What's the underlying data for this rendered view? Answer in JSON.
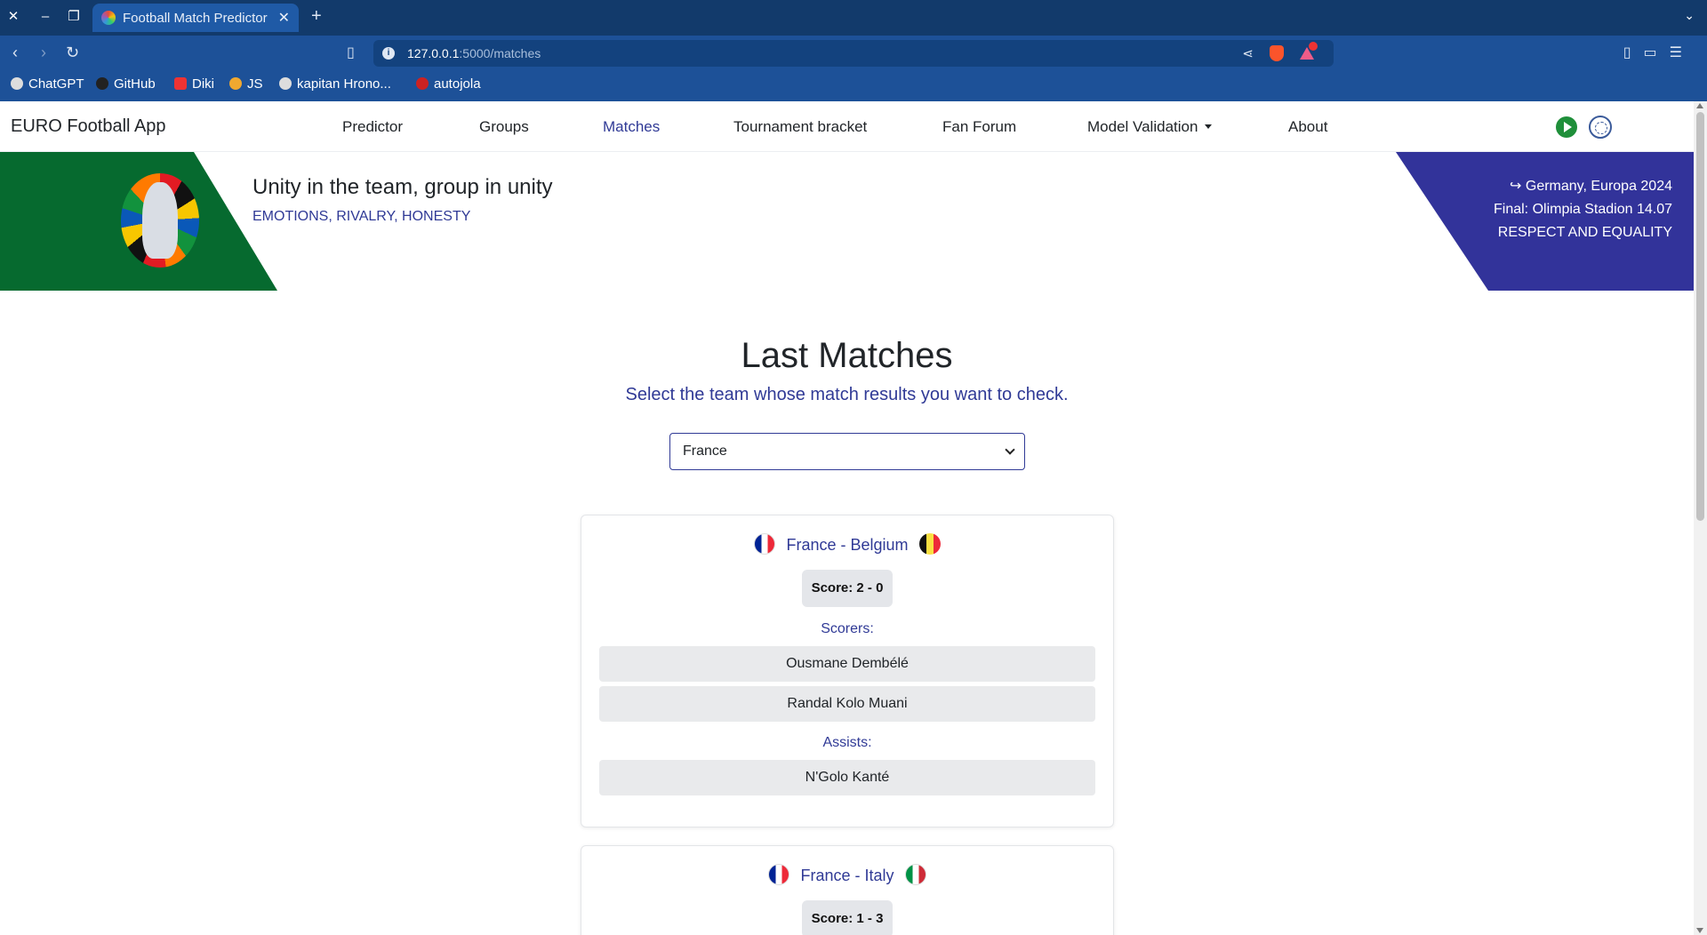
{
  "browser": {
    "tab_title": "Football Match Predictor",
    "url_host": "127.0.0.1",
    "url_path": ":5000/matches",
    "bookmarks": [
      "ChatGPT",
      "GitHub",
      "Diki",
      "JS",
      "kapitan Hrono...",
      "autojola"
    ]
  },
  "navbar": {
    "brand": "EURO Football App",
    "links": [
      "Predictor",
      "Groups",
      "Matches",
      "Tournament bracket",
      "Fan Forum",
      "Model Validation",
      "About"
    ],
    "active": "Matches"
  },
  "banner": {
    "slogan": "Unity in the team, group in unity",
    "subtitle": "EMOTIONS, RIVALRY, HONESTY",
    "info": [
      "↪ Germany, Europa 2024",
      "Final: Olimpia Stadion 14.07",
      "RESPECT AND EQUALITY"
    ]
  },
  "main": {
    "heading": "Last Matches",
    "lead": "Select the team whose match results you want to check.",
    "team_select": {
      "value": "France"
    }
  },
  "matches": [
    {
      "title": "France - Belgium",
      "score": "Score: 2 - 0",
      "scorers_label": "Scorers:",
      "scorers": [
        "Ousmane Dembélé",
        "Randal Kolo Muani"
      ],
      "assists_label": "Assists:",
      "assists": [
        "N'Golo Kanté"
      ]
    },
    {
      "title": "France - Italy",
      "score": "Score: 1 - 3"
    }
  ],
  "colors": {
    "accent": "#303a96",
    "banner_green": "#066a2f",
    "banner_purple": "#32339a",
    "browser_chrome": "#1d5198"
  }
}
